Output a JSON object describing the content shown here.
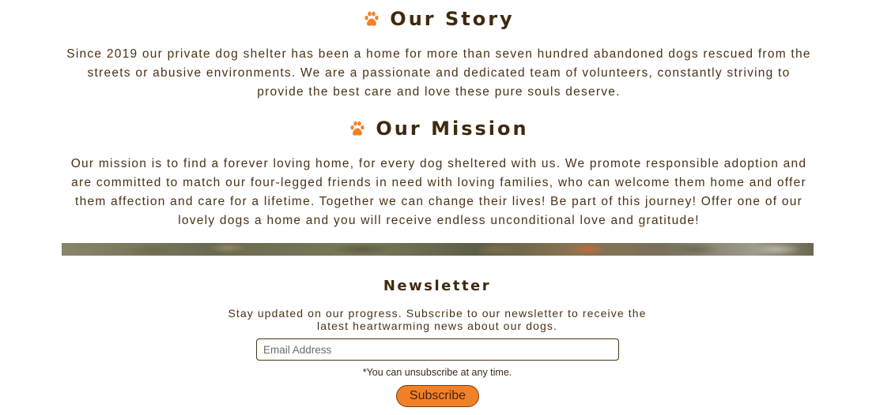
{
  "story": {
    "title": "Our Story",
    "text": "Since 2019 our private dog shelter has been a home for more than seven hundred abandoned dogs rescued from the streets or abusive environments. We are a passionate and dedicated team of volunteers, constantly striving to provide the best care and love these pure souls deserve."
  },
  "mission": {
    "title": "Our Mission",
    "text": "Our mission is to find a forever loving home, for every dog sheltered with us. We promote responsible adoption and are committed to match our four-legged friends in need with loving families, who can welcome them home and offer them affection and care for a lifetime. Together we can change their lives! Be part of this journey! Offer one of our lovely dogs a home and you will receive endless unconditional love and gratitude!"
  },
  "newsletter": {
    "title": "Newsletter",
    "text": "Stay updated on our progress. Subscribe to our newsletter to receive the latest heartwarming news about our dogs.",
    "email_placeholder": "Email Address",
    "email_value": "",
    "note": "*You can unsubscribe at any time.",
    "subscribe_label": "Subscribe"
  },
  "icons": {
    "heading_icon": "paw-icon"
  },
  "colors": {
    "accent": "#f08129",
    "text": "#4a3216",
    "heading": "#3f2a10"
  }
}
